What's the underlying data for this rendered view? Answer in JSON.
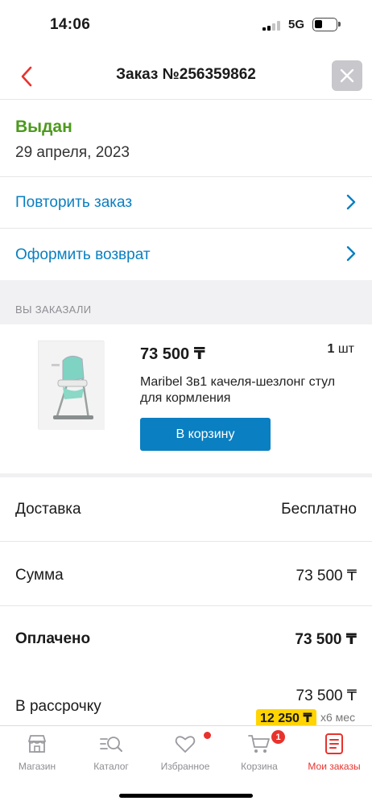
{
  "status_bar": {
    "time": "14:06",
    "network": "5G"
  },
  "header": {
    "title": "Заказ №256359862"
  },
  "order": {
    "status": "Выдан",
    "date": "29 апреля, 2023",
    "status_color": "#4c9a1c"
  },
  "actions": [
    {
      "label": "Повторить заказ"
    },
    {
      "label": "Оформить возврат"
    }
  ],
  "section_title": "ВЫ ЗАКАЗАЛИ",
  "product": {
    "price": "73 500 ₸",
    "qty_number": "1",
    "qty_unit": "шт",
    "name": "Maribel 3в1 качеля-шезлонг стул для кормления",
    "cart_button": "В корзину"
  },
  "summary": {
    "delivery_label": "Доставка",
    "delivery_value": "Бесплатно",
    "sum_label": "Сумма",
    "sum_value": "73 500 ₸",
    "paid_label": "Оплачено",
    "paid_value": "73 500 ₸",
    "installment_label": "В рассрочку",
    "installment_value": "73 500 ₸",
    "installment_monthly": "12 250 ₸",
    "installment_months": "х6 мес"
  },
  "tabs": [
    {
      "label": "Магазин",
      "icon": "store-icon"
    },
    {
      "label": "Каталог",
      "icon": "catalog-search-icon"
    },
    {
      "label": "Избранное",
      "icon": "heart-icon"
    },
    {
      "label": "Корзина",
      "icon": "cart-icon",
      "badge": "1"
    },
    {
      "label": "Мои заказы",
      "icon": "orders-icon",
      "active": true
    }
  ],
  "colors": {
    "accent_blue": "#0a7fc1",
    "active_red": "#e8322d",
    "installment_yellow": "#ffd400"
  }
}
